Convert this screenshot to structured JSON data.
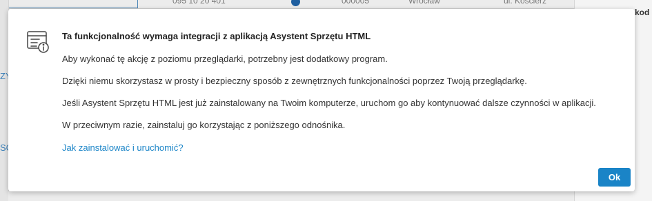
{
  "background": {
    "top_cells": [
      "095 10 20 401",
      "000005",
      "Wrocław",
      "ul. Kościerz"
    ],
    "right_text": "kod p",
    "left_fragments": [
      "ZY",
      "SC"
    ]
  },
  "modal": {
    "icon": "document-info-icon",
    "title": "Ta funkcjonalność wymaga integracji z aplikacją Asystent Sprzętu HTML",
    "paragraphs": [
      "Aby wykonać tę akcję z poziomu przeglądarki, potrzebny jest dodatkowy program.",
      "Dzięki niemu skorzystasz w prosty i bezpieczny sposób z zewnętrznych funkcjonalności poprzez Twoją przeglądarkę.",
      "Jeśli Asystent Sprzętu HTML jest już zainstalowany na Twoim komputerze, uruchom go aby kontynuować dalsze czynności w aplikacji.",
      "W przeciwnym razie, zainstaluj go korzystając z poniższego odnośnika."
    ],
    "link_label": "Jak zainstalować i uruchomić?",
    "ok_label": "Ok"
  },
  "colors": {
    "accent": "#1a84c7",
    "highlight_column": "#f2f0cf"
  }
}
